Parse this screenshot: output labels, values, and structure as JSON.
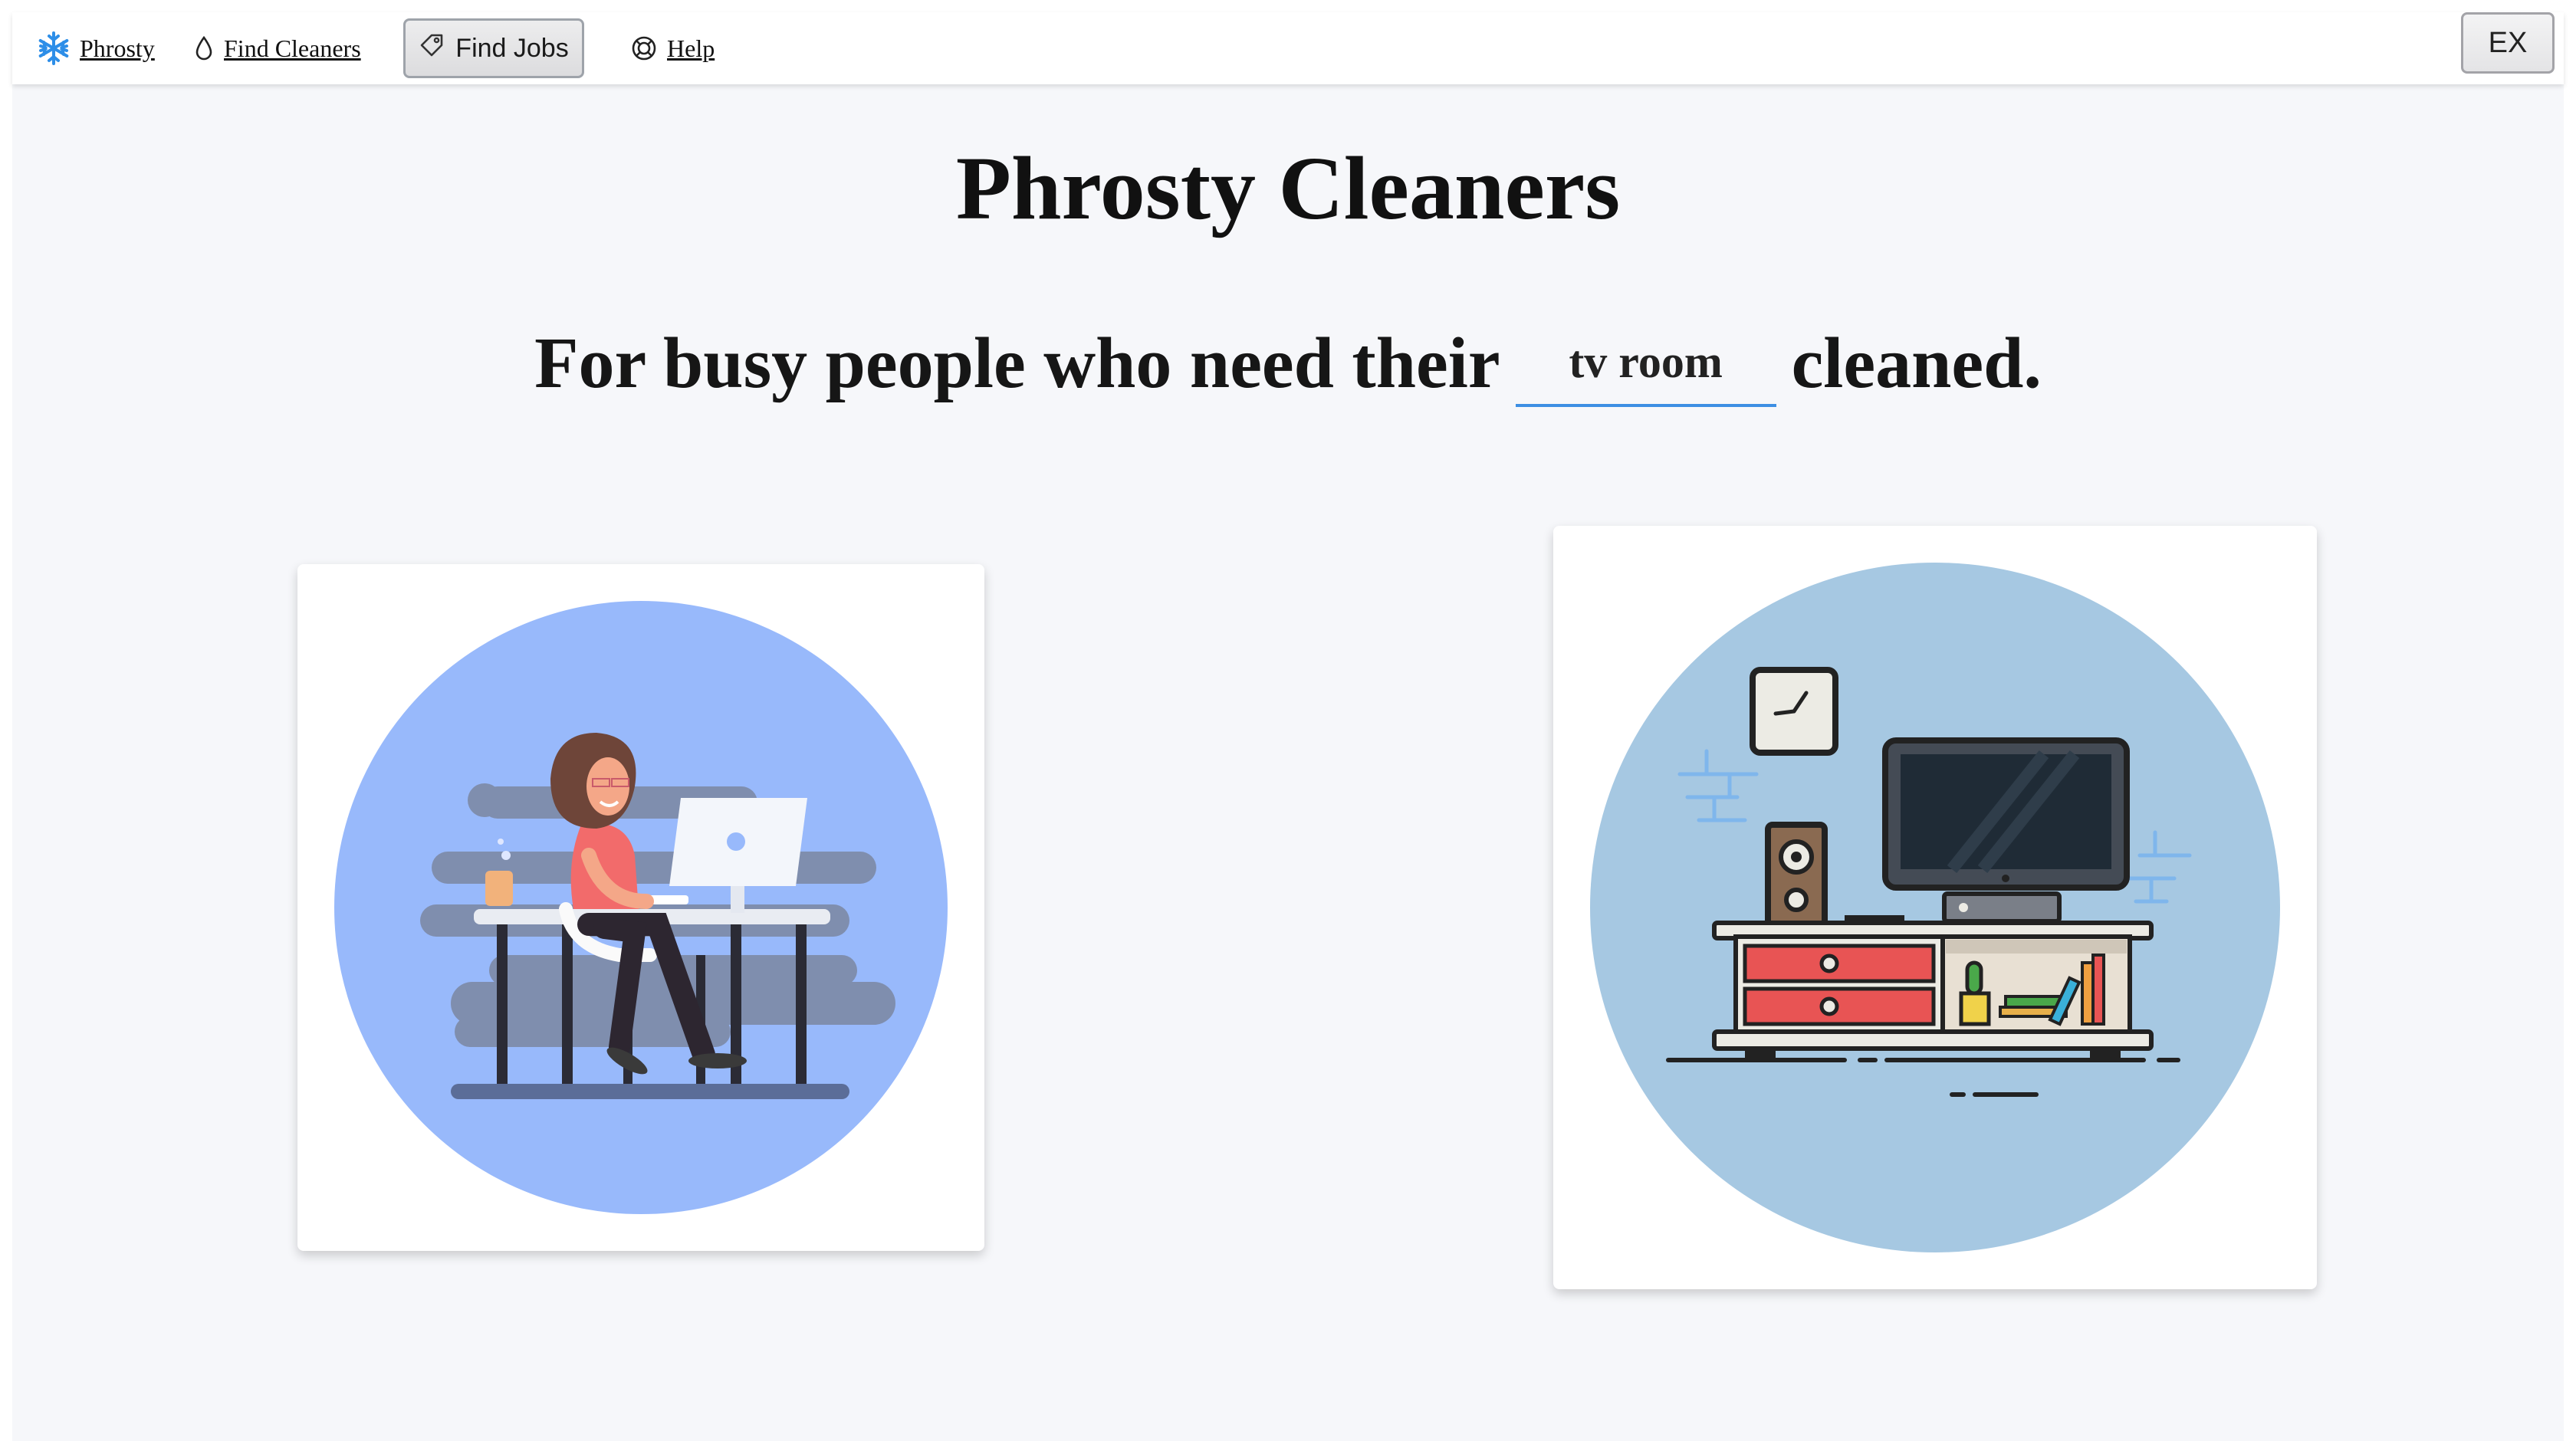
{
  "nav": {
    "brand_label": "Phrosty",
    "find_cleaners_label": "Find Cleaners",
    "find_jobs_label": "Find Jobs",
    "help_label": "Help",
    "ex_label": "EX"
  },
  "hero": {
    "title": "Phrosty Cleaners",
    "tagline_prefix": "For busy people who need their",
    "room_value": "tv room",
    "tagline_suffix": "cleaned."
  },
  "colors": {
    "accent": "#3d8fe3",
    "background": "#f6f7fa",
    "left_circle": "#98b9fb",
    "right_circle": "#a6c8e2"
  },
  "icons": {
    "brand": "snowflake-icon",
    "find_cleaners": "droplet-icon",
    "find_jobs": "tag-icon",
    "help": "lifebuoy-icon"
  }
}
